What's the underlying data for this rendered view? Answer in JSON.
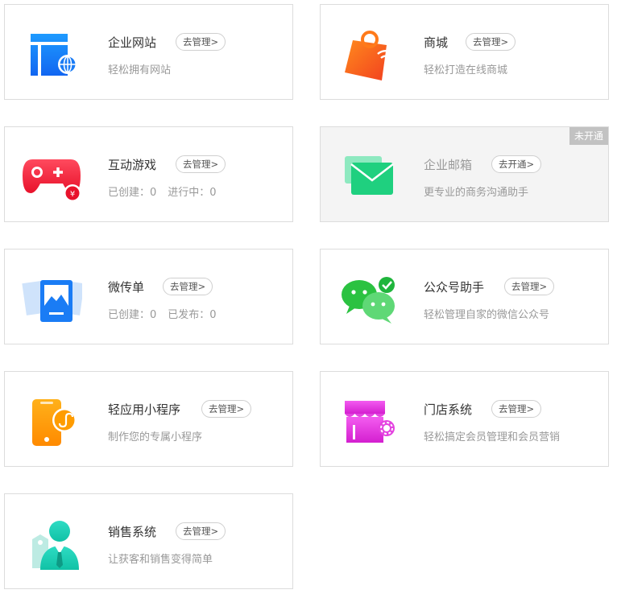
{
  "cards": [
    {
      "title": "企业网站",
      "button": "去管理>",
      "subtitle": "轻松拥有网站",
      "icon": "website-icon"
    },
    {
      "title": "商城",
      "button": "去管理>",
      "subtitle": "轻松打造在线商城",
      "icon": "shopping-bag-icon"
    },
    {
      "title": "互动游戏",
      "button": "去管理>",
      "stats": [
        "已创建：0",
        "进行中：0"
      ],
      "icon": "gamepad-icon"
    },
    {
      "title": "企业邮箱",
      "button": "去开通>",
      "subtitle": "更专业的商务沟通助手",
      "icon": "mail-icon",
      "badge": "未开通"
    },
    {
      "title": "微传单",
      "button": "去管理>",
      "stats": [
        "已创建：0",
        "已发布：0"
      ],
      "icon": "flyer-icon"
    },
    {
      "title": "公众号助手",
      "button": "去管理>",
      "subtitle": "轻松管理自家的微信公众号",
      "icon": "wechat-icon"
    },
    {
      "title": "轻应用小程序",
      "button": "去管理>",
      "subtitle": "制作您的专属小程序",
      "icon": "mini-program-icon"
    },
    {
      "title": "门店系统",
      "button": "去管理>",
      "subtitle": "轻松搞定会员管理和会员营销",
      "icon": "store-icon"
    },
    {
      "title": "销售系统",
      "button": "去管理>",
      "subtitle": "让获客和销售变得简单",
      "icon": "salesperson-icon"
    }
  ],
  "colors": {
    "border": "#dcdcdc",
    "disabled_bg": "#f4f4f4",
    "badge_bg": "#c2c2c2"
  }
}
